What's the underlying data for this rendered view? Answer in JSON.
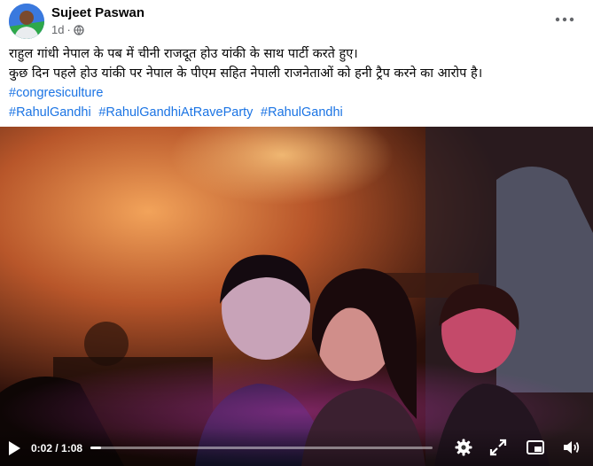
{
  "post": {
    "author": "Sujeet Paswan",
    "time": "1d",
    "time_separator": "·",
    "text_line1": "राहुल गांधी नेपाल के पब में चीनी राजदूत होउ यांकी के साथ पार्टी करते हुए।",
    "text_line2": " कुछ दिन पहले होउ यांकी पर नेपाल के पीएम सहित नेपाली राजनेताओं को हनी ट्रैप करने का आरोप है।",
    "hashtags_line1": [
      "#congresiculture"
    ],
    "hashtags_line2": [
      "#RahulGandhi",
      "#RahulGandhiAtRaveParty",
      "#RahulGandhi"
    ]
  },
  "video": {
    "current_time": "0:02",
    "duration": "1:08",
    "time_separator": " / ",
    "progress_fraction": 0.03
  },
  "colors": {
    "link": "#1b74e4",
    "author": "#050505",
    "meta": "#65676b"
  },
  "icons": {
    "privacy": "globe-icon",
    "more": "more-options-icon",
    "play": "play-icon",
    "settings": "settings-gear-icon",
    "expand": "expand-icon",
    "pip": "picture-in-picture-icon",
    "fullscreen": "fullscreen-icon",
    "volume": "volume-icon"
  }
}
